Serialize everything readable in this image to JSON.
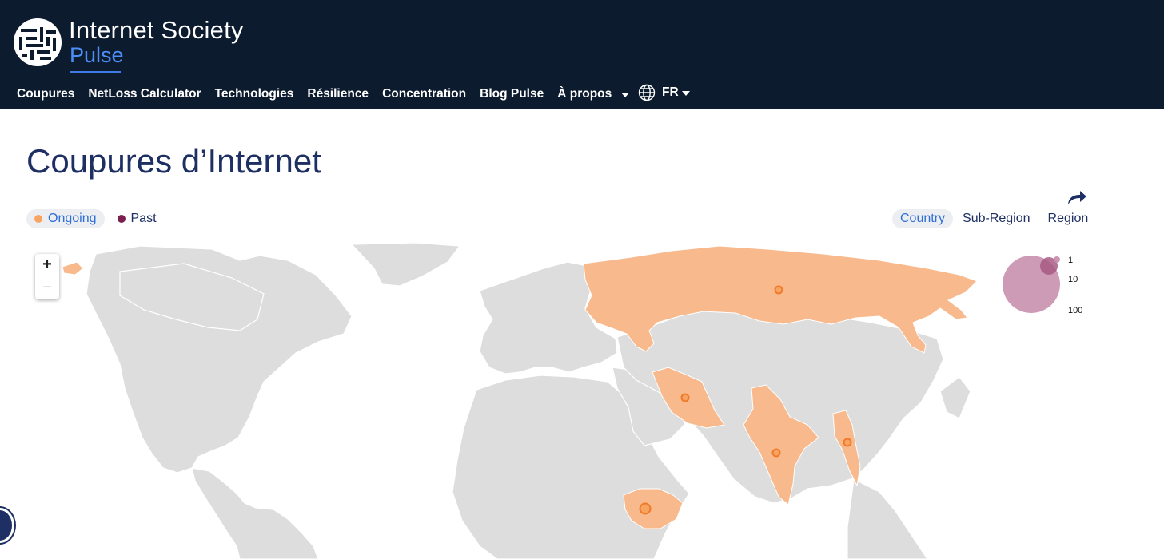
{
  "brand": {
    "name": "Internet Society",
    "subname": "Pulse"
  },
  "nav": {
    "items": [
      {
        "label": "Coupures"
      },
      {
        "label": "NetLoss Calculator"
      },
      {
        "label": "Technologies"
      },
      {
        "label": "Résilience"
      },
      {
        "label": "Concentration"
      },
      {
        "label": "Blog Pulse"
      },
      {
        "label": "À propos"
      }
    ],
    "language": "FR"
  },
  "page": {
    "title": "Coupures d’Internet"
  },
  "filters": {
    "status": {
      "ongoing": "Ongoing",
      "past": "Past",
      "selected": "Ongoing"
    },
    "scope": {
      "country": "Country",
      "subregion": "Sub-Region",
      "region": "Region",
      "selected": "Country"
    }
  },
  "colors": {
    "header_bg": "#0d1b2e",
    "ongoing": "#f7a463",
    "past": "#7b1f4f",
    "land": "#dddddd",
    "affected_land": "#f8b98c",
    "marker": "#f07a2a",
    "accent": "#2f6fd8",
    "title": "#1d2f63"
  },
  "map": {
    "zoom_in": "+",
    "zoom_out": "−",
    "size_legend": [
      "1",
      "10",
      "100"
    ]
  },
  "icons": {
    "globe": "globe-icon",
    "share": "share-arrow-icon",
    "caret": "chevron-down-icon",
    "help": "help-icon"
  }
}
